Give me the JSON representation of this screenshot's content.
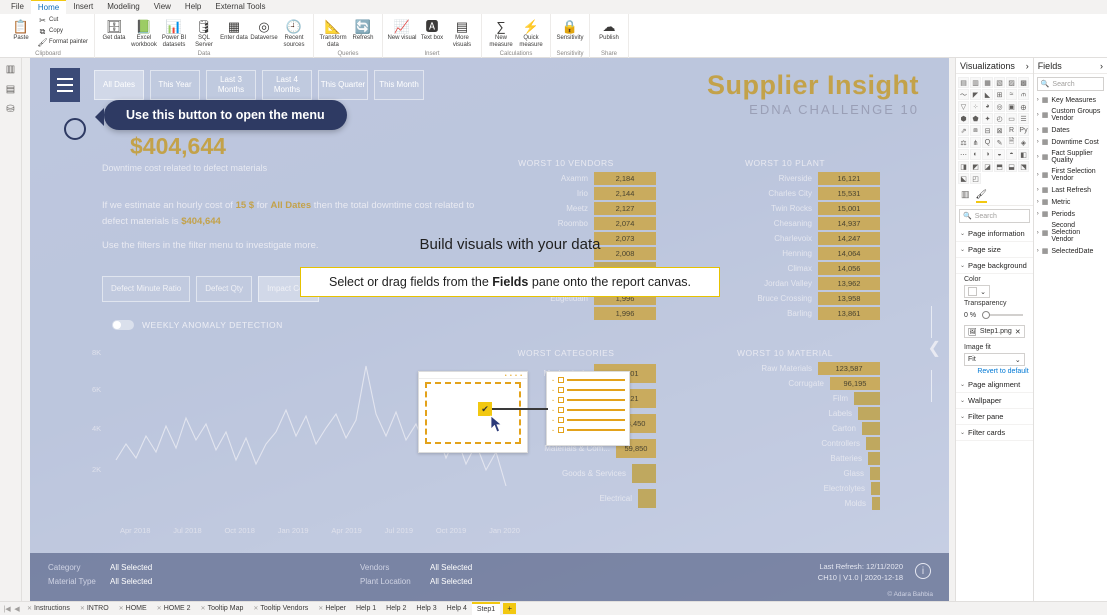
{
  "app": {
    "ribbon_tabs": [
      {
        "label": "File",
        "active": false
      },
      {
        "label": "Home",
        "active": true
      },
      {
        "label": "Insert",
        "active": false
      },
      {
        "label": "Modeling",
        "active": false
      },
      {
        "label": "View",
        "active": false
      },
      {
        "label": "Help",
        "active": false
      },
      {
        "label": "External Tools",
        "active": false
      }
    ],
    "ribbon_groups": [
      {
        "label": "Clipboard",
        "items": [
          {
            "label": "Paste",
            "icon": "clipboard-icon",
            "size": "large"
          },
          {
            "label": "Cut",
            "icon": "scissors-icon",
            "size": "small"
          },
          {
            "label": "Copy",
            "icon": "copy-icon",
            "size": "small"
          },
          {
            "label": "Format painter",
            "icon": "brush-icon",
            "size": "small"
          }
        ]
      },
      {
        "label": "Data",
        "items": [
          {
            "label": "Get data",
            "icon": "database-icon",
            "size": "large"
          },
          {
            "label": "Excel workbook",
            "icon": "excel-icon",
            "size": "large"
          },
          {
            "label": "Power BI datasets",
            "icon": "powerbi-icon",
            "size": "large"
          },
          {
            "label": "SQL Server",
            "icon": "sql-icon",
            "size": "large"
          },
          {
            "label": "Enter data",
            "icon": "table-icon",
            "size": "large"
          },
          {
            "label": "Dataverse",
            "icon": "dataverse-icon",
            "size": "large"
          },
          {
            "label": "Recent sources",
            "icon": "recent-icon",
            "size": "large"
          }
        ]
      },
      {
        "label": "Queries",
        "items": [
          {
            "label": "Transform data",
            "icon": "transform-icon",
            "size": "large"
          },
          {
            "label": "Refresh",
            "icon": "refresh-icon",
            "size": "large"
          }
        ]
      },
      {
        "label": "Insert",
        "items": [
          {
            "label": "New visual",
            "icon": "chart-icon",
            "size": "large"
          },
          {
            "label": "Text box",
            "icon": "textbox-icon",
            "size": "large"
          },
          {
            "label": "More visuals",
            "icon": "more-visuals-icon",
            "size": "large"
          }
        ]
      },
      {
        "label": "Calculations",
        "items": [
          {
            "label": "New measure",
            "icon": "measure-icon",
            "size": "large"
          },
          {
            "label": "Quick measure",
            "icon": "quick-measure-icon",
            "size": "large"
          }
        ]
      },
      {
        "label": "Sensitivity",
        "items": [
          {
            "label": "Sensitivity",
            "icon": "sensitivity-icon",
            "size": "large"
          }
        ]
      },
      {
        "label": "Share",
        "items": [
          {
            "label": "Publish",
            "icon": "publish-icon",
            "size": "large"
          }
        ]
      }
    ]
  },
  "report": {
    "title": "Supplier Insight",
    "subtitle": "EDNA CHALLENGE 10",
    "date_pills": [
      {
        "label": "All Dates",
        "selected": true
      },
      {
        "label": "This Year",
        "selected": false
      },
      {
        "label": "Last 3 Months",
        "selected": false
      },
      {
        "label": "Last 4 Months",
        "selected": false
      },
      {
        "label": "This Quarter",
        "selected": false
      },
      {
        "label": "This Month",
        "selected": false
      }
    ],
    "kpi_value": "$404,644",
    "kpi_caption": "Downtime cost related to defect materials",
    "paragraph_1_a": "If we estimate an hourly cost of ",
    "paragraph_1_rate": "15 $",
    "paragraph_1_b": " for ",
    "paragraph_1_scope": "All Dates",
    "paragraph_1_c": " then the total downtime cost related to defect materials is ",
    "paragraph_1_value": "$404,644",
    "paragraph_2": "Use the filters in the filter menu to investigate more.",
    "metric_buttons": [
      {
        "label": "Defect Minute Ratio",
        "selected": false
      },
      {
        "label": "Defect Qty",
        "selected": false
      },
      {
        "label": "Impact Cost",
        "selected": true
      }
    ],
    "anomaly_toggle_label": "WEEKLY ANOMALY DETECTION",
    "y_ticks": [
      "8K",
      "6K",
      "4K",
      "2K"
    ],
    "x_ticks": [
      "Apr 2018",
      "Jul 2018",
      "Oct 2018",
      "Jan 2019",
      "Apr 2019",
      "Jul 2019",
      "Oct 2019",
      "Jan 2020"
    ],
    "panels": [
      {
        "title": "WORST 10 VENDORS",
        "rows": [
          {
            "name": "Axamm",
            "value": "2,184"
          },
          {
            "name": "Irio",
            "value": "2,144"
          },
          {
            "name": "Meetz",
            "value": "2,127"
          },
          {
            "name": "Roombo",
            "value": "2,074"
          },
          {
            "name": "",
            "value": "2,073"
          },
          {
            "name": "",
            "value": "2,008"
          },
          {
            "name": "",
            "value": ""
          },
          {
            "name": "",
            "value": ""
          },
          {
            "name": "Edgetidain",
            "value": "1,996"
          },
          {
            "name": "",
            "value": "1,996"
          }
        ]
      },
      {
        "title": "WORST 10 PLANT",
        "rows": [
          {
            "name": "Riverside",
            "value": "16,121"
          },
          {
            "name": "Charles City",
            "value": "15,531"
          },
          {
            "name": "Twin Rocks",
            "value": "15,001"
          },
          {
            "name": "Chesaning",
            "value": "14,937"
          },
          {
            "name": "Charlevoix",
            "value": "14,247"
          },
          {
            "name": "Henning",
            "value": "14,064"
          },
          {
            "name": "Climax",
            "value": "14,056"
          },
          {
            "name": "Jordan Valley",
            "value": "13,962"
          },
          {
            "name": "Bruce Crossing",
            "value": "13,958"
          },
          {
            "name": "Barling",
            "value": "13,861"
          }
        ]
      },
      {
        "title": "WORST CATEGORIES",
        "rows": [
          {
            "name": "Mechanicals",
            "value": "125,701"
          },
          {
            "name": "Logistics",
            "value": "107,121"
          },
          {
            "name": "Packaging",
            "value": "68,450"
          },
          {
            "name": "Materials & Com...",
            "value": "59,850"
          },
          {
            "name": "Goods & Services",
            "value": ""
          },
          {
            "name": "Electrical",
            "value": ""
          }
        ]
      },
      {
        "title": "WORST 10 MATERIAL",
        "rows": [
          {
            "name": "Raw Materials",
            "value": "123,587"
          },
          {
            "name": "Corrugate",
            "value": "96,195"
          },
          {
            "name": "Film",
            "value": ""
          },
          {
            "name": "Labels",
            "value": ""
          },
          {
            "name": "Carton",
            "value": ""
          },
          {
            "name": "Controllers",
            "value": ""
          },
          {
            "name": "Batteries",
            "value": ""
          },
          {
            "name": "Glass",
            "value": ""
          },
          {
            "name": "Electrolytes",
            "value": ""
          },
          {
            "name": "Molds",
            "value": ""
          }
        ]
      }
    ],
    "footer_filters": [
      {
        "label": "Category",
        "value": "All Selected"
      },
      {
        "label": "Material Type",
        "value": "All Selected"
      },
      {
        "label": "Vendors",
        "value": "All Selected"
      },
      {
        "label": "Plant Location",
        "value": "All Selected"
      }
    ],
    "last_refresh": "Last Refresh: 12/11/2020",
    "version": "CH10 | V1.0 | 2020-12-18",
    "watermark": "© Adara Bahbia"
  },
  "callouts": {
    "menu_hint": "Use this button to open the menu",
    "onboard_title": "Build visuals with your data",
    "onboard_sub_a": "Select or drag fields from the ",
    "onboard_sub_bold": "Fields",
    "onboard_sub_b": " pane onto the report canvas."
  },
  "visualizations": {
    "header": "Visualizations",
    "search_placeholder": "Search",
    "format_tabs": [
      {
        "icon": "bar-chart-icon",
        "active": false
      },
      {
        "icon": "paint-roller-icon",
        "active": true
      }
    ],
    "sections": [
      {
        "label": "Page information"
      },
      {
        "label": "Page size"
      },
      {
        "label": "Page background",
        "expanded": true
      },
      {
        "label": "Page alignment"
      },
      {
        "label": "Wallpaper"
      },
      {
        "label": "Filter pane"
      },
      {
        "label": "Filter cards"
      }
    ],
    "page_background": {
      "color_label": "Color",
      "transparency_label": "Transparency",
      "transparency_value": "0 %",
      "image_name": "Step1.png",
      "image_fit_label": "Image fit",
      "image_fit_value": "Fit",
      "revert_label": "Revert to default"
    }
  },
  "fields": {
    "header": "Fields",
    "search_placeholder": "Search",
    "tables": [
      {
        "label": "Key Measures"
      },
      {
        "label": "Custom Groups Vendor"
      },
      {
        "label": "Dates"
      },
      {
        "label": "Downtime Cost"
      },
      {
        "label": "Fact Supplier Quality"
      },
      {
        "label": "First Selection Vendor"
      },
      {
        "label": "Last Refresh"
      },
      {
        "label": "Metric"
      },
      {
        "label": "Periods"
      },
      {
        "label": "Second Selection Vendor"
      },
      {
        "label": "SelectedDate"
      }
    ]
  },
  "page_tabs": [
    {
      "label": "Instructions",
      "active": false
    },
    {
      "label": "INTRO",
      "active": false
    },
    {
      "label": "HOME",
      "active": false
    },
    {
      "label": "HOME 2",
      "active": false
    },
    {
      "label": "Tooltip Map",
      "active": false
    },
    {
      "label": "Tooltip Vendors",
      "active": false
    },
    {
      "label": "Helper",
      "active": false
    },
    {
      "label": "Help 1",
      "active": false
    },
    {
      "label": "Help 2",
      "active": false
    },
    {
      "label": "Help 3",
      "active": false
    },
    {
      "label": "Help 4",
      "active": false
    },
    {
      "label": "Step1",
      "active": true
    }
  ],
  "page_tab_add": "+"
}
